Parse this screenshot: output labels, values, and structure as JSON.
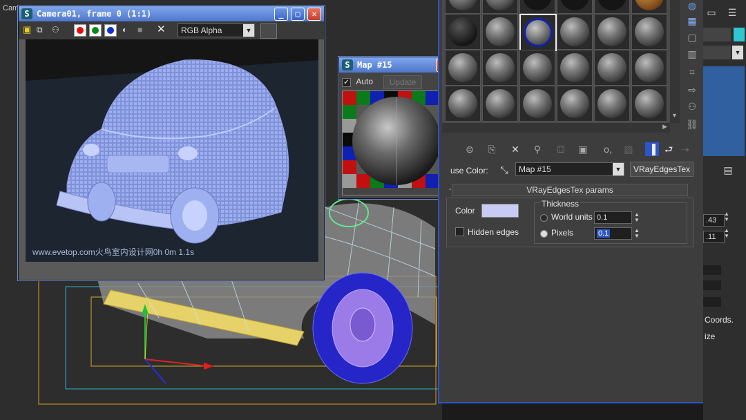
{
  "viewport": {
    "label": "Cam"
  },
  "camera_window": {
    "title": "Camera01, frame 0 (1:1)",
    "channel": "RGB Alpha",
    "footer": "www.evetop.com火鸟室内设计网0h 0m 1.1s",
    "channel_colors": {
      "red": "#e01010",
      "green": "#0a8a1a",
      "blue": "#1030d0"
    }
  },
  "map_window": {
    "title": "Map #15",
    "auto_label": "Auto",
    "update_label": "Update"
  },
  "material_editor": {
    "diffuse_label": "use Color:",
    "map_name": "Map #15",
    "map_type": "VRayEdgesTex",
    "rollout_title": "VRayEdgesTex params",
    "color_label": "Color",
    "edge_color": "#c8ccf4",
    "thickness_label": "Thickness",
    "world_units_label": "World units",
    "world_units_value": "0.1",
    "pixels_label": "Pixels",
    "pixels_value": "0.1",
    "hidden_edges_label": "Hidden edges"
  },
  "right_panel": {
    "field1": ".43",
    "field2": ".11",
    "coords_label": "Coords.",
    "size_label": "ize"
  }
}
